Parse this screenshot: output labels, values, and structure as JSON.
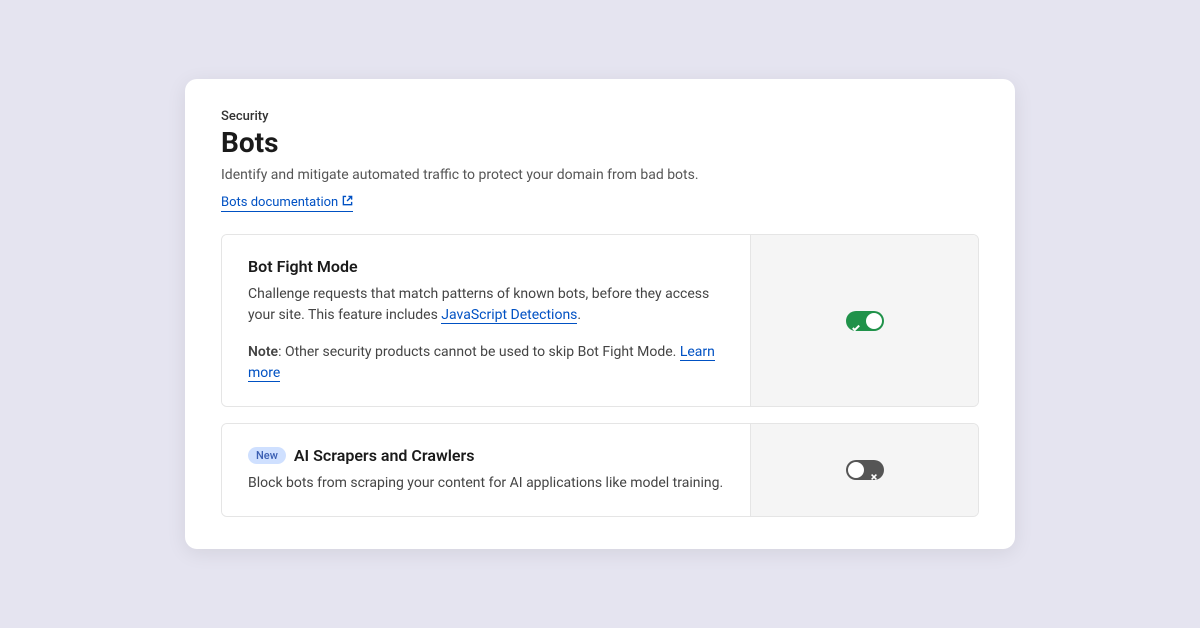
{
  "header": {
    "breadcrumb": "Security",
    "title": "Bots",
    "description": "Identify and mitigate automated traffic to protect your domain from bad bots.",
    "doc_link_text": "Bots documentation"
  },
  "settings": {
    "bot_fight_mode": {
      "title": "Bot Fight Mode",
      "desc_pre": "Challenge requests that match patterns of known bots, before they access your site. This feature includes ",
      "desc_link": "JavaScript Detections",
      "desc_post": ".",
      "note_label": "Note",
      "note_text": ": Other security products cannot be used to skip Bot Fight Mode. ",
      "note_link": "Learn more",
      "enabled": true
    },
    "ai_scrapers": {
      "badge": "New",
      "title": "AI Scrapers and Crawlers",
      "desc": "Block bots from scraping your content for AI applications like model training.",
      "enabled": false
    }
  }
}
